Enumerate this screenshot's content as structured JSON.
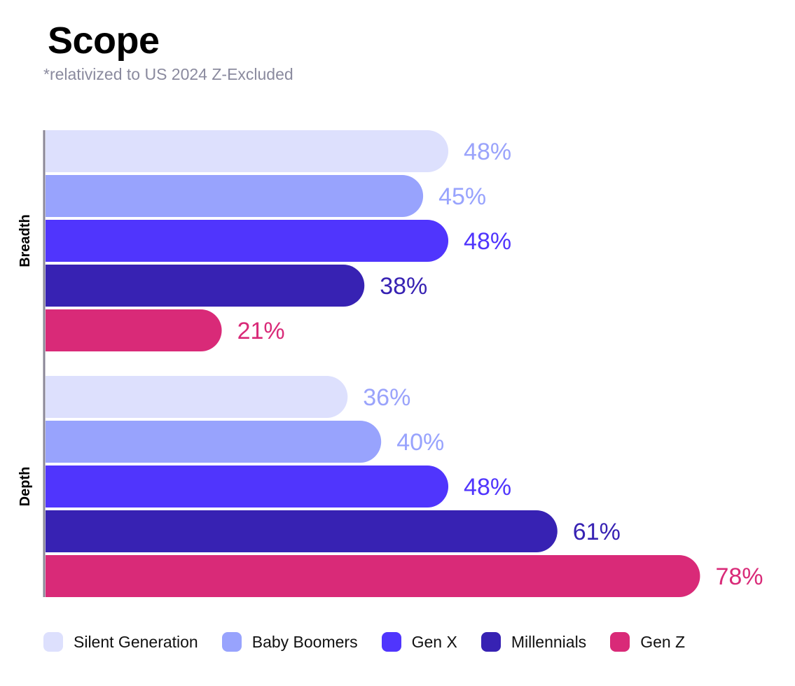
{
  "chart_data": {
    "type": "bar",
    "orientation": "horizontal",
    "title": "Scope",
    "subtitle": "*relativized to US 2024 Z-Excluded",
    "categories": [
      "Breadth",
      "Depth"
    ],
    "xlabel": "",
    "ylabel": "",
    "xlim": [
      0,
      80
    ],
    "grid": false,
    "legend_position": "bottom",
    "value_suffix": "%",
    "series": [
      {
        "name": "Silent Generation",
        "color": "#dde0fd",
        "label_color": "#9aa3fb",
        "values": [
          48,
          36
        ]
      },
      {
        "name": "Baby Boomers",
        "color": "#98a3fd",
        "label_color": "#98a3fd",
        "values": [
          45,
          40
        ]
      },
      {
        "name": "Gen X",
        "color": "#5035fd",
        "label_color": "#5035fd",
        "values": [
          48,
          48
        ]
      },
      {
        "name": "Millennials",
        "color": "#3722b3",
        "label_color": "#3722b3",
        "values": [
          38,
          61
        ]
      },
      {
        "name": "Gen Z",
        "color": "#d92a78",
        "label_color": "#d92a78",
        "values": [
          21,
          78
        ]
      }
    ],
    "data_labels": {
      "Breadth": [
        "48%",
        "45%",
        "48%",
        "38%",
        "21%"
      ],
      "Depth": [
        "36%",
        "40%",
        "48%",
        "61%",
        "78%"
      ]
    },
    "axis_color": "#8a8696"
  }
}
